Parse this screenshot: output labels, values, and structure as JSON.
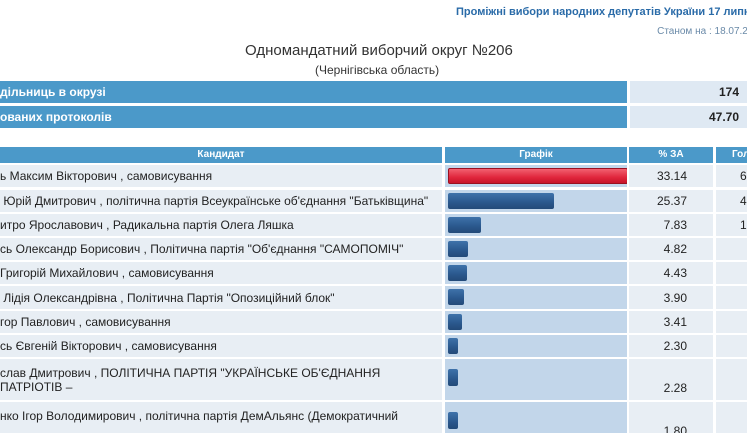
{
  "header": {
    "election_title": "Проміжні вибори народних депутатів України 17 липня",
    "status": "Станом на : 18.07.201",
    "district_title": "Одномандатний виборчий округ №206",
    "region": "(Чернігівська область)"
  },
  "summary": [
    {
      "label": "дільниць в окрузі",
      "value": "174"
    },
    {
      "label": "ованих протоколів",
      "value": "47.70"
    }
  ],
  "table": {
    "headers": {
      "candidate": "Кандидат",
      "chart": "Графік",
      "percent": "% ЗА",
      "votes": "Гол"
    },
    "rows": [
      {
        "name": "ь Максим Вікторович , самовисування",
        "percent": "33.14",
        "extra": "6"
      },
      {
        "name": " Юрій Дмитрович , політична партія Всеукраїнське об'єднання \"Батьківщина\"",
        "percent": "25.37",
        "extra": "4"
      },
      {
        "name": "итро Ярославович , Радикальна партія Олега Ляшка",
        "percent": "7.83",
        "extra": "1"
      },
      {
        "name": "сь Олександр Борисович , Політична партія \"Об'єднання \"САМОПОМІЧ\"",
        "percent": "4.82",
        "extra": ""
      },
      {
        "name": "Григорій Михайлович , самовисування",
        "percent": "4.43",
        "extra": ""
      },
      {
        "name": " Лідія Олександрівна , Політична Партія \"Опозиційний блок\"",
        "percent": "3.90",
        "extra": ""
      },
      {
        "name": "гор Павлович , самовисування",
        "percent": "3.41",
        "extra": ""
      },
      {
        "name": "сь Євгеній Вікторович , самовисування",
        "percent": "2.30",
        "extra": ""
      },
      {
        "name": "слав Дмитрович , ПОЛІТИЧНА ПАРТІЯ \"УКРАЇНСЬКЕ ОБ'ЄДНАННЯ ПАТРІОТІВ –",
        "percent": "2.28",
        "extra": ""
      },
      {
        "name": "нко Ігор Володимирович , політична партія ДемАльянс (Демократичний",
        "percent": "1.80",
        "extra": ""
      }
    ]
  },
  "colors": {
    "header_blue": "#4b99c9",
    "bar_blue": "#2a578c",
    "bar_top_red": "#e0263c",
    "chart_bg": "#c2d6ea"
  }
}
